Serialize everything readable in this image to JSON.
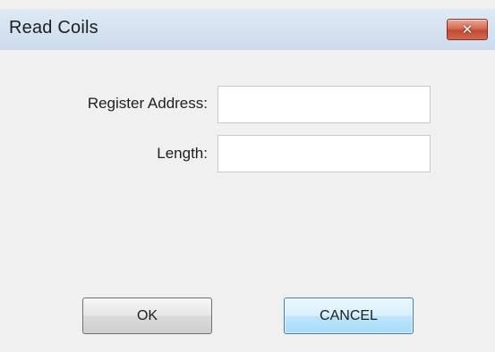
{
  "window": {
    "title": "Read Coils",
    "close_icon": "close-icon",
    "close_glyph": "✕"
  },
  "form": {
    "register_address_label": "Register Address:",
    "register_address_value": "",
    "length_label": "Length:",
    "length_value": ""
  },
  "buttons": {
    "ok_label": "OK",
    "cancel_label": "CANCEL"
  },
  "colors": {
    "titlebar": "#d3e1f0",
    "close_button": "#c9553b",
    "dialog_background": "#f0f0f0",
    "cancel_button_focus": "#3c7fb1"
  }
}
